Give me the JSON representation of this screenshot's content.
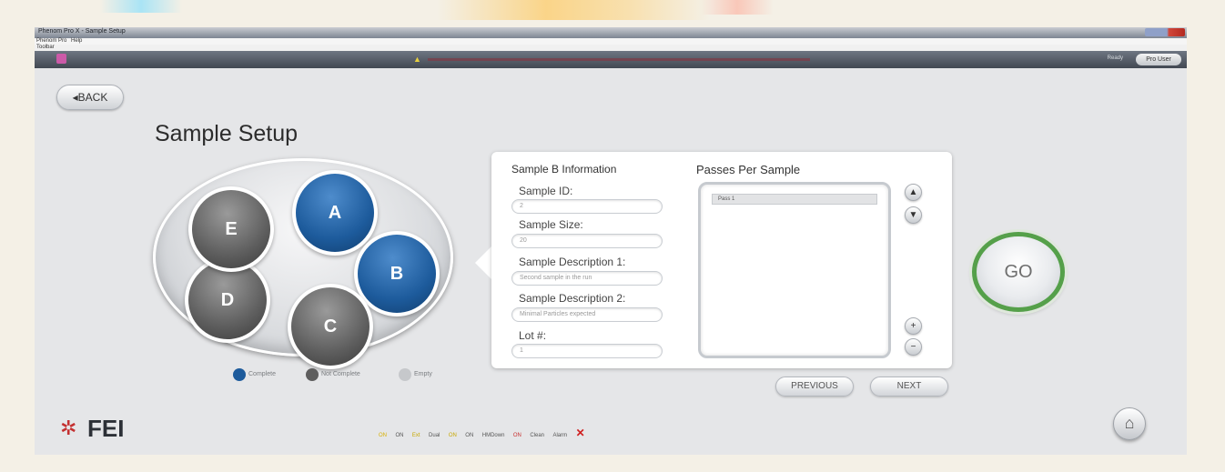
{
  "window": {
    "title": "Phenom Pro X - Sample Setup",
    "menu": [
      "Phenom Pro",
      "Help"
    ],
    "toolbar_label": "Toolbar",
    "user_button": "Pro User",
    "ready_text": "Ready",
    "warning_icon": "warning-icon"
  },
  "nav": {
    "back_label": "◂BACK"
  },
  "page": {
    "title": "Sample Setup"
  },
  "carousel": {
    "slots": [
      {
        "id": "A",
        "status": "complete"
      },
      {
        "id": "B",
        "status": "complete"
      },
      {
        "id": "C",
        "status": "not-complete"
      },
      {
        "id": "D",
        "status": "not-complete"
      },
      {
        "id": "E",
        "status": "not-complete"
      }
    ],
    "legend": [
      {
        "label": "Complete",
        "color": "#1d5b9c"
      },
      {
        "label": "Not Complete",
        "color": "#5e5e5e"
      },
      {
        "label": "Empty",
        "color": "#c6c8cb"
      }
    ]
  },
  "sample_info": {
    "heading": "Sample B Information",
    "fields": [
      {
        "label": "Sample ID:",
        "value": "2"
      },
      {
        "label": "Sample Size:",
        "value": "20"
      },
      {
        "label": "Sample Description 1:",
        "value": "Second sample in the run"
      },
      {
        "label": "Sample Description 2:",
        "value": "Minimal Particles expected"
      },
      {
        "label": "Lot #:",
        "value": "1"
      }
    ]
  },
  "passes": {
    "heading": "Passes Per Sample",
    "items": [
      "Pass 1"
    ]
  },
  "buttons": {
    "previous": "PREVIOUS",
    "next": "NEXT",
    "go": "GO"
  },
  "logo": {
    "text": "FEI"
  },
  "status_bar": [
    "ON",
    "ON",
    "Ext",
    "Dual",
    "ON",
    "ON",
    "HMDown",
    "ON",
    "Clean",
    "Alarm"
  ],
  "colors": {
    "complete": "#1d5b9c",
    "not_complete": "#5e5e5e",
    "go_ring": "#55a04a",
    "logo_red": "#c43030"
  }
}
